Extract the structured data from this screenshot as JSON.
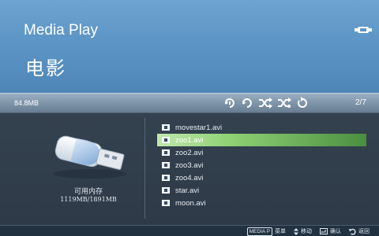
{
  "header": {
    "app_title": "Media Play",
    "section_title": "电影",
    "device_icon": "usb-device-icon"
  },
  "status_bar": {
    "storage_size": "84.8MB",
    "page_indicator": "2/7",
    "mode_icons": [
      "repeat-one-icon",
      "repeat-all-icon",
      "shuffle-icon",
      "shuffle-repeat-icon",
      "refresh-icon"
    ]
  },
  "device": {
    "memory_label": "可用内存",
    "memory_value": "1119MB/1891MB"
  },
  "files": [
    {
      "name": "movestar1.avi",
      "selected": false
    },
    {
      "name": "zoo1.avi",
      "selected": true
    },
    {
      "name": "zoo2.avi",
      "selected": false
    },
    {
      "name": "zoo3.avi",
      "selected": false
    },
    {
      "name": "zoo4.avi",
      "selected": false
    },
    {
      "name": "star.avi",
      "selected": false
    },
    {
      "name": "moon.avi",
      "selected": false
    }
  ],
  "footer": {
    "media_key": "MEDIA P",
    "menu_label": "菜单",
    "move_label": "移动",
    "confirm_label": "确认",
    "back_label": "返回"
  },
  "colors": {
    "header_blue": "#5c95c6",
    "selection_green": "#8fd173",
    "background": "#2d3a4a"
  }
}
